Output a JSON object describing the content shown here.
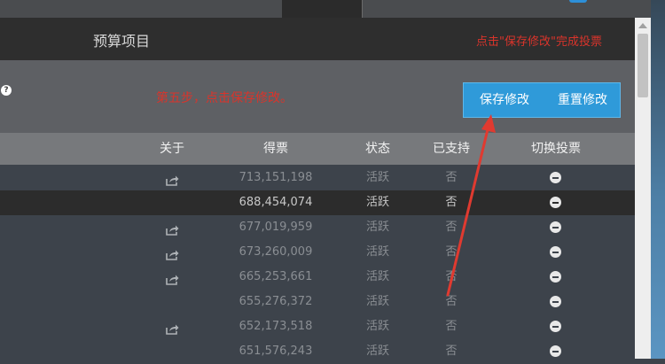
{
  "header": {
    "title": "预算项目",
    "annotation": "点击\"保存修改\"完成投票"
  },
  "toolbar": {
    "help_icon": "question-circle-icon",
    "step_text": "第五步，点击保存修改。",
    "save_label": "保存修改",
    "reset_label": "重置修改",
    "button_color": "#2f9ad9"
  },
  "table": {
    "columns": [
      "关于",
      "得票",
      "状态",
      "已支持",
      "切换投票"
    ],
    "rows": [
      {
        "about_icon": "share-icon",
        "votes": "713,151,198",
        "status": "活跃",
        "supported": "否",
        "toggle_icon": "minus-circle-icon"
      },
      {
        "about_icon": "",
        "votes": "688,454,074",
        "status": "活跃",
        "supported": "否",
        "toggle_icon": "minus-circle-icon"
      },
      {
        "about_icon": "share-icon",
        "votes": "677,019,959",
        "status": "活跃",
        "supported": "否",
        "toggle_icon": "minus-circle-icon"
      },
      {
        "about_icon": "share-icon",
        "votes": "673,260,009",
        "status": "活跃",
        "supported": "否",
        "toggle_icon": "minus-circle-icon"
      },
      {
        "about_icon": "share-icon",
        "votes": "665,253,661",
        "status": "活跃",
        "supported": "否",
        "toggle_icon": "minus-circle-icon"
      },
      {
        "about_icon": "",
        "votes": "655,276,372",
        "status": "活跃",
        "supported": "否",
        "toggle_icon": "minus-circle-icon"
      },
      {
        "about_icon": "share-icon",
        "votes": "652,173,518",
        "status": "活跃",
        "supported": "否",
        "toggle_icon": "minus-circle-icon"
      },
      {
        "about_icon": "",
        "votes": "651,576,243",
        "status": "活跃",
        "supported": "否",
        "toggle_icon": "minus-circle-icon"
      }
    ]
  },
  "colors": {
    "annotation_red": "#d9342b",
    "highlight_row": "#2c2c2c",
    "arrow_red": "#e03a30"
  }
}
